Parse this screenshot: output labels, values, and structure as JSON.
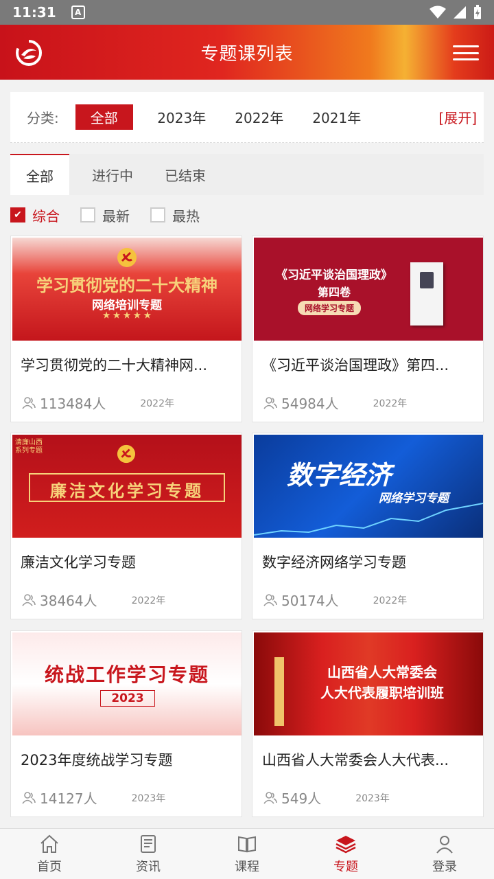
{
  "status_bar": {
    "time": "11:31",
    "badge": "A"
  },
  "header": {
    "title": "专题课列表"
  },
  "category": {
    "label": "分类:",
    "options": [
      "全部",
      "2023年",
      "2022年",
      "2021年"
    ],
    "selected": "全部",
    "expand": "[展开]"
  },
  "tabs": [
    "全部",
    "进行中",
    "已结束"
  ],
  "sorts": [
    {
      "label": "综合",
      "checked": true
    },
    {
      "label": "最新",
      "checked": false
    },
    {
      "label": "最热",
      "checked": false
    }
  ],
  "cards": [
    {
      "title": "学习贯彻党的二十大精神网...",
      "count": "113484人",
      "year": "2022年",
      "banner_lines": [
        "学习贯彻党的二十大精神",
        "网络培训专题"
      ]
    },
    {
      "title": "《习近平谈治国理政》第四...",
      "count": "54984人",
      "year": "2022年",
      "banner_lines": [
        "《习近平谈治国理政》",
        "第四卷",
        "网络学习专题"
      ]
    },
    {
      "title": "廉洁文化学习专题",
      "count": "38464人",
      "year": "2022年",
      "banner_lines": [
        "廉洁文化学习专题",
        "清廉山西",
        "系列专题"
      ]
    },
    {
      "title": "数字经济网络学习专题",
      "count": "50174人",
      "year": "2022年",
      "banner_lines": [
        "数字经济",
        "网络学习专题"
      ]
    },
    {
      "title": "2023年度统战学习专题",
      "count": "14127人",
      "year": "2023年",
      "banner_lines": [
        "统战工作学习专题",
        "2023"
      ]
    },
    {
      "title": "山西省人大常委会人大代表...",
      "count": "549人",
      "year": "2023年",
      "banner_lines": [
        "山西省人大常委会",
        "人大代表履职培训班"
      ]
    }
  ],
  "bottom_nav": [
    {
      "label": "首页",
      "icon": "home-icon"
    },
    {
      "label": "资讯",
      "icon": "news-icon"
    },
    {
      "label": "课程",
      "icon": "book-icon"
    },
    {
      "label": "专题",
      "icon": "layers-icon",
      "active": true
    },
    {
      "label": "登录",
      "icon": "user-icon"
    }
  ],
  "colors": {
    "brand_red": "#c8161d",
    "header_gradient_start": "#c8121a",
    "header_gradient_glow": "#f5b133"
  }
}
